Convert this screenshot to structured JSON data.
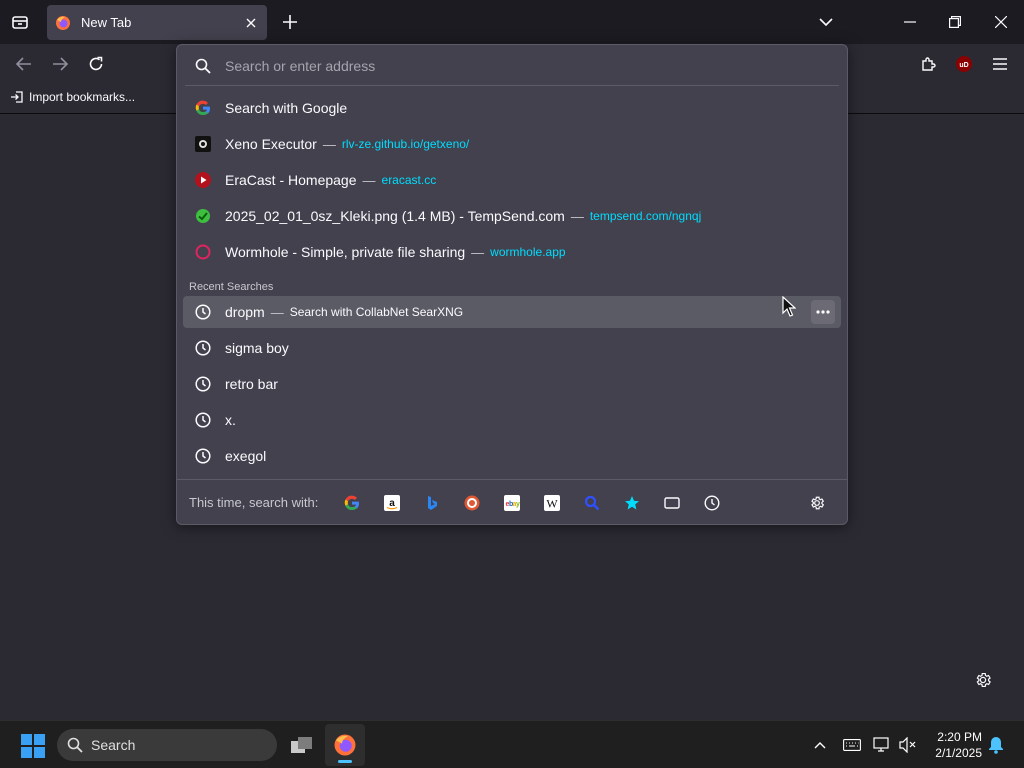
{
  "tab": {
    "title": "New Tab"
  },
  "bookmarks": {
    "import_label": "Import bookmarks..."
  },
  "urlbar": {
    "placeholder": "Search or enter address",
    "results": [
      {
        "title": "Search with Google",
        "url": "",
        "favicon": "google-icon"
      },
      {
        "title": "Xeno Executor",
        "url": "rlv-ze.github.io/getxeno/",
        "favicon": "xeno-icon"
      },
      {
        "title": "EraCast - Homepage",
        "url": "eracast.cc",
        "favicon": "eracast-icon"
      },
      {
        "title": "2025_02_01_0sz_Kleki.png (1.4 MB) - TempSend.com",
        "url": "tempsend.com/ngnqj",
        "favicon": "tempsend-icon"
      },
      {
        "title": "Wormhole - Simple, private file sharing",
        "url": "wormhole.app",
        "favicon": "wormhole-icon"
      }
    ],
    "dash": "—",
    "recent_heading": "Recent Searches",
    "recent": [
      {
        "text": "dropm",
        "sub": "Search with CollabNet SearXNG"
      },
      {
        "text": "sigma boy"
      },
      {
        "text": "retro bar"
      },
      {
        "text": "x."
      },
      {
        "text": "exegol"
      }
    ],
    "search_with_label": "This time, search with:",
    "engines": [
      "google-icon",
      "amazon-icon",
      "bing-icon",
      "duckduckgo-icon",
      "ebay-icon",
      "wikipedia-icon",
      "searxng-icon",
      "bookmarks-star-icon",
      "tabs-icon",
      "history-icon"
    ]
  },
  "taskbar": {
    "search_label": "Search",
    "time": "2:20 PM",
    "date": "2/1/2025"
  },
  "colors": {
    "accent": "#00ddff",
    "panel": "#42414d",
    "selected": "#5b5b66"
  }
}
